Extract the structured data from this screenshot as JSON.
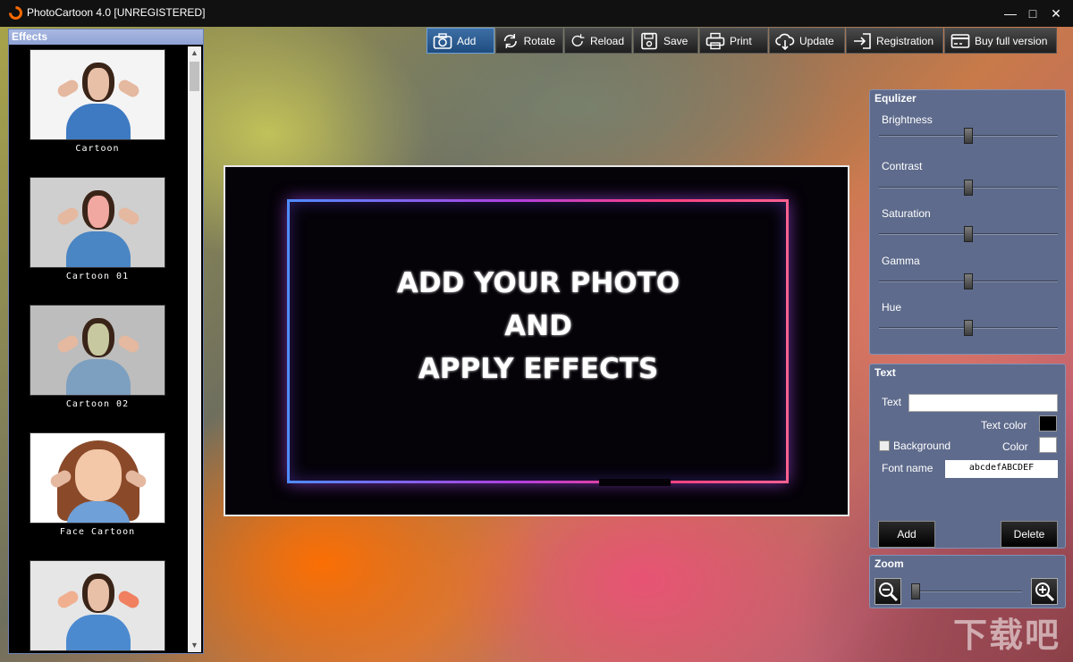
{
  "window": {
    "title": "PhotoCartoon 4.0 [UNREGISTERED]",
    "controls": [
      "minimize",
      "maximize",
      "close"
    ]
  },
  "effects_panel": {
    "title": "Effects",
    "items": [
      {
        "label": "Cartoon",
        "icon": "effect-thumbnail"
      },
      {
        "label": "Cartoon 01",
        "icon": "effect-thumbnail"
      },
      {
        "label": "Cartoon 02",
        "icon": "effect-thumbnail"
      },
      {
        "label": "Face Cartoon",
        "icon": "effect-thumbnail"
      },
      {
        "label": "",
        "icon": "effect-thumbnail"
      }
    ]
  },
  "toolbar": {
    "buttons": [
      {
        "label": "Add",
        "icon": "camera-icon",
        "active": true
      },
      {
        "label": "Rotate",
        "icon": "rotate-icon"
      },
      {
        "label": "Reload",
        "icon": "reload-icon"
      },
      {
        "label": "Save",
        "icon": "save-icon"
      },
      {
        "label": "Print",
        "icon": "print-icon"
      },
      {
        "label": "Update",
        "icon": "cloud-download-icon"
      },
      {
        "label": "Registration",
        "icon": "sign-in-icon"
      },
      {
        "label": "Buy full version",
        "icon": "credit-card-icon"
      }
    ]
  },
  "canvas": {
    "lines": [
      "ADD YOUR PHOTO",
      "AND",
      "APPLY EFFECTS"
    ]
  },
  "equalizer": {
    "title": "Equlizer",
    "sliders": [
      {
        "label": "Brightness",
        "value": 0.5
      },
      {
        "label": "Contrast",
        "value": 0.5
      },
      {
        "label": "Saturation",
        "value": 0.5
      },
      {
        "label": "Gamma",
        "value": 0.5
      },
      {
        "label": "Hue",
        "value": 0.5
      }
    ]
  },
  "text_panel": {
    "title": "Text",
    "text_label": "Text",
    "text_value": "",
    "text_color_label": "Text color",
    "text_color": "#000000",
    "background_label": "Background",
    "background_checked": false,
    "color_label": "Color",
    "background_color": "#ffffff",
    "font_name_label": "Font name",
    "font_sample": "abcdefABCDEF",
    "add_label": "Add",
    "delete_label": "Delete"
  },
  "zoom_panel": {
    "title": "Zoom",
    "value": 0.0
  },
  "watermark": "下载吧"
}
